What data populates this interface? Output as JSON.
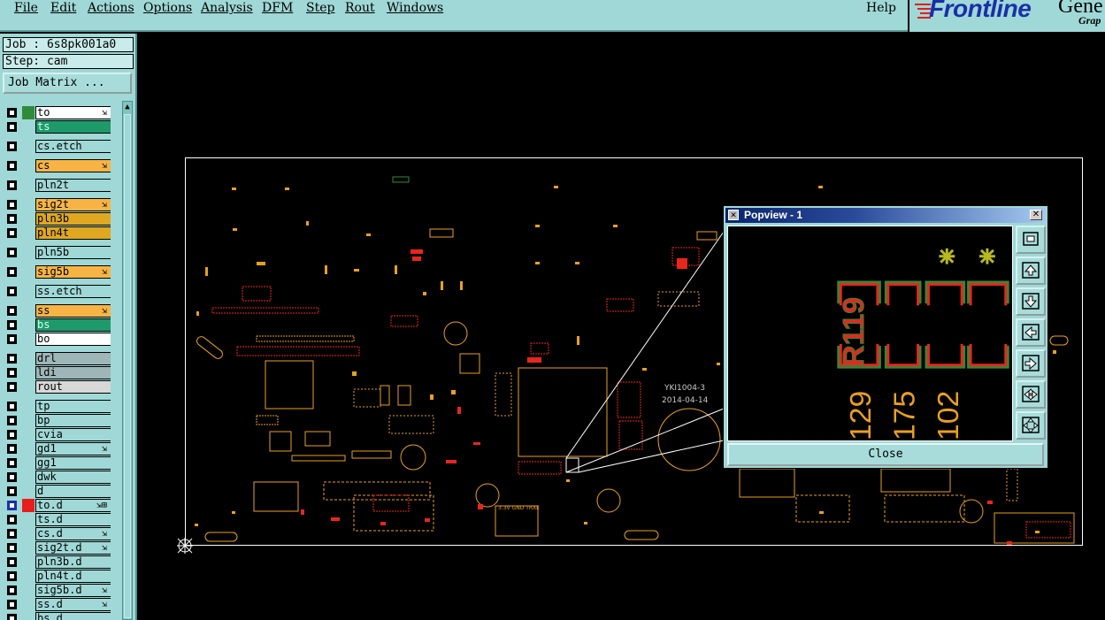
{
  "menubar": {
    "items": [
      "File",
      "Edit",
      "Actions",
      "Options",
      "Analysis",
      "DFM",
      "Step",
      "Rout",
      "Windows"
    ],
    "help": "Help"
  },
  "logo": {
    "brand": "Frontline",
    "product": "Gene",
    "subtitle": "Grap"
  },
  "job": {
    "label": "Job : 6s8pk001a0",
    "step": "Step: cam"
  },
  "job_matrix_button": "Job Matrix ...",
  "layers": [
    {
      "name": "to",
      "color": "#ffffff",
      "swatch": "#2e8b3a",
      "mark": "⇲"
    },
    {
      "name": "ts",
      "color": "#1e9a6a",
      "swatch": "",
      "mark": "",
      "light": true
    },
    {
      "name": "cs.etch",
      "color": "#9fd8d6",
      "swatch": "",
      "mark": "",
      "gap": true
    },
    {
      "name": "cs",
      "color": "#f7b445",
      "swatch": "",
      "mark": "⇲",
      "gap": true
    },
    {
      "name": "pln2t",
      "color": "#9fd8d6",
      "swatch": "",
      "mark": "",
      "gap": true
    },
    {
      "name": "sig2t",
      "color": "#f7b445",
      "swatch": "",
      "mark": "⇲",
      "gap": true
    },
    {
      "name": "pln3b",
      "color": "#e0a820",
      "swatch": "",
      "mark": ""
    },
    {
      "name": "pln4t",
      "color": "#e0a820",
      "swatch": "",
      "mark": ""
    },
    {
      "name": "pln5b",
      "color": "#9fd8d6",
      "swatch": "",
      "mark": "",
      "gap": true
    },
    {
      "name": "sig5b",
      "color": "#f7b445",
      "swatch": "",
      "mark": "⇲",
      "gap": true
    },
    {
      "name": "ss.etch",
      "color": "#9fd8d6",
      "swatch": "",
      "mark": "",
      "gap": true
    },
    {
      "name": "ss",
      "color": "#f7b445",
      "swatch": "",
      "mark": "⇲",
      "gap": true
    },
    {
      "name": "bs",
      "color": "#1e9a6a",
      "swatch": "",
      "mark": "",
      "light": true
    },
    {
      "name": "bo",
      "color": "#ffffff",
      "swatch": "",
      "mark": ""
    },
    {
      "name": "drl",
      "color": "#9fb6b8",
      "swatch": "",
      "mark": "",
      "gap": true
    },
    {
      "name": "ldi",
      "color": "#9fb6b8",
      "swatch": "",
      "mark": ""
    },
    {
      "name": "rout",
      "color": "#d8d8d8",
      "swatch": "",
      "mark": ""
    },
    {
      "name": "tp",
      "color": "#9fd8d6",
      "swatch": "",
      "mark": "",
      "gap": true
    },
    {
      "name": "bp",
      "color": "#9fd8d6",
      "swatch": "",
      "mark": ""
    },
    {
      "name": "cvia",
      "color": "#9fd8d6",
      "swatch": "",
      "mark": ""
    },
    {
      "name": "gd1",
      "color": "#9fd8d6",
      "swatch": "",
      "mark": "⇲"
    },
    {
      "name": "gg1",
      "color": "#9fd8d6",
      "swatch": "",
      "mark": ""
    },
    {
      "name": "dwk",
      "color": "#9fd8d6",
      "swatch": "",
      "mark": ""
    },
    {
      "name": "d",
      "color": "#9fd8d6",
      "swatch": "",
      "mark": ""
    },
    {
      "name": "to.d",
      "color": "#9fd8d6",
      "swatch": "#e81c1c",
      "mark": "⇲⊞",
      "on": true
    },
    {
      "name": "ts.d",
      "color": "#9fd8d6",
      "swatch": "",
      "mark": ""
    },
    {
      "name": "cs.d",
      "color": "#9fd8d6",
      "swatch": "",
      "mark": "⇲"
    },
    {
      "name": "sig2t.d",
      "color": "#9fd8d6",
      "swatch": "",
      "mark": "⇲"
    },
    {
      "name": "pln3b.d",
      "color": "#9fd8d6",
      "swatch": "",
      "mark": ""
    },
    {
      "name": "pln4t.d",
      "color": "#9fd8d6",
      "swatch": "",
      "mark": ""
    },
    {
      "name": "sig5b.d",
      "color": "#9fd8d6",
      "swatch": "",
      "mark": "⇲"
    },
    {
      "name": "ss.d",
      "color": "#9fd8d6",
      "swatch": "",
      "mark": "⇲"
    },
    {
      "name": "bs.d",
      "color": "#9fd8d6",
      "swatch": "",
      "mark": ""
    }
  ],
  "board": {
    "silk_text_1": "YKI1004-3",
    "silk_text_2": "2014-04-14",
    "silk_text_3": "3.3V GND TRXE"
  },
  "popview": {
    "title": "Popview - 1",
    "close_label": "Close",
    "refdes": "R119",
    "labels": [
      "129",
      "175",
      "102"
    ],
    "tools": [
      "zoom-fit-icon",
      "arrow-up-icon",
      "arrow-down-icon",
      "arrow-left-icon",
      "arrow-right-icon",
      "zoom-in-icon",
      "zoom-out-icon"
    ]
  },
  "colors": {
    "panel": "#9fd8d6",
    "pad": "#e8a020",
    "copper": "#e8261c",
    "accent_green": "#2e8b3a"
  }
}
